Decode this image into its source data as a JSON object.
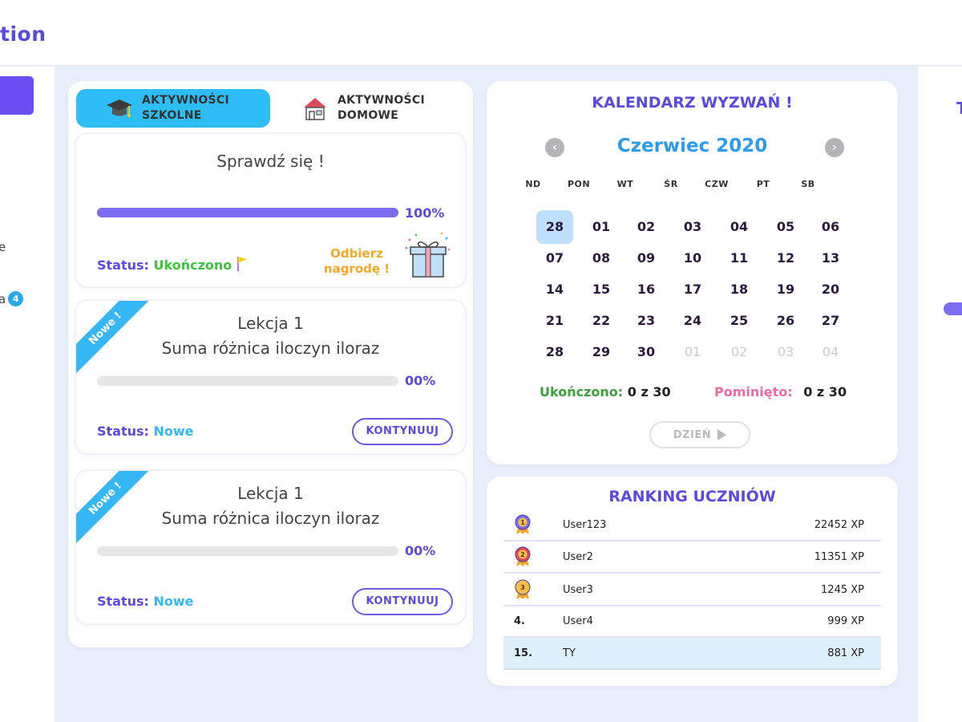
{
  "app": {
    "brand_fragment": "tion"
  },
  "sidebar": {
    "item_partial_1": "e",
    "item_partial_2": "a",
    "item_partial_2_badge": "4"
  },
  "right_panel": {
    "partial_title": "T"
  },
  "tabs": {
    "school": {
      "line1": "AKTYWNOŚCI",
      "line2": "SZKOLNE",
      "icon": "graduation-cap-icon",
      "active": true
    },
    "home": {
      "line1": "AKTYWNOŚCI",
      "line2": "DOMOWE",
      "icon": "house-icon",
      "active": false
    }
  },
  "activities": [
    {
      "title": "Sprawdź się !",
      "progress": 100,
      "progress_label": "100%",
      "status_label": "Status:",
      "status_value": "Ukończono",
      "reward_line1": "Odbierz",
      "reward_line2": "nagrodę !"
    },
    {
      "ribbon": "Nowe !",
      "title_line1": "Lekcja 1",
      "title_line2": "Suma różnica iloczyn iloraz",
      "progress": 0,
      "progress_label": "00%",
      "status_label": "Status:",
      "status_value": "Nowe",
      "button": "KONTYNUUJ"
    },
    {
      "ribbon": "Nowe !",
      "title_line1": "Lekcja 1",
      "title_line2": "Suma różnica iloczyn iloraz",
      "progress": 0,
      "progress_label": "00%",
      "status_label": "Status:",
      "status_value": "Nowe",
      "button": "KONTYNUUJ"
    }
  ],
  "calendar": {
    "title": "KALENDARZ WYZWAŃ !",
    "month": "Czerwiec 2020",
    "weekdays": [
      "ND",
      "PON",
      "WT",
      "ŚR",
      "CZW",
      "PT",
      "SB"
    ],
    "weeks": [
      [
        "28",
        "01",
        "02",
        "03",
        "04",
        "05",
        "06"
      ],
      [
        "07",
        "08",
        "09",
        "10",
        "11",
        "12",
        "13"
      ],
      [
        "14",
        "15",
        "16",
        "17",
        "18",
        "19",
        "20"
      ],
      [
        "21",
        "22",
        "23",
        "24",
        "25",
        "26",
        "27"
      ],
      [
        "28",
        "29",
        "30",
        "01",
        "02",
        "03",
        "04"
      ]
    ],
    "selected": "28",
    "completed_label": "Ukończono:",
    "completed_value": "0 z 30",
    "skipped_label": "Pominięto:",
    "skipped_value": "0 z 30",
    "day_button": "DZIEŃ"
  },
  "ranking": {
    "title": "RANKING UCZNIÓW",
    "rows": [
      {
        "pos": "1",
        "medal": "purple-medal-icon",
        "name": "User123",
        "xp": "22452 XP"
      },
      {
        "pos": "2",
        "medal": "red-medal-icon",
        "name": "User2",
        "xp": "11351 XP"
      },
      {
        "pos": "3",
        "medal": "gold-medal-icon",
        "name": "User3",
        "xp": "1245 XP"
      },
      {
        "pos": "4.",
        "name": "User4",
        "xp": "999 XP"
      },
      {
        "pos": "15.",
        "name": "TY",
        "xp": "881 XP",
        "me": true
      }
    ]
  },
  "colors": {
    "accent": "#5a4ae0",
    "tab_active": "#2fbdf5",
    "progress": "#7c6cf0",
    "done": "#3cc43c",
    "new": "#35b6f5",
    "reward": "#f5a623",
    "skipped": "#f06aa0"
  }
}
